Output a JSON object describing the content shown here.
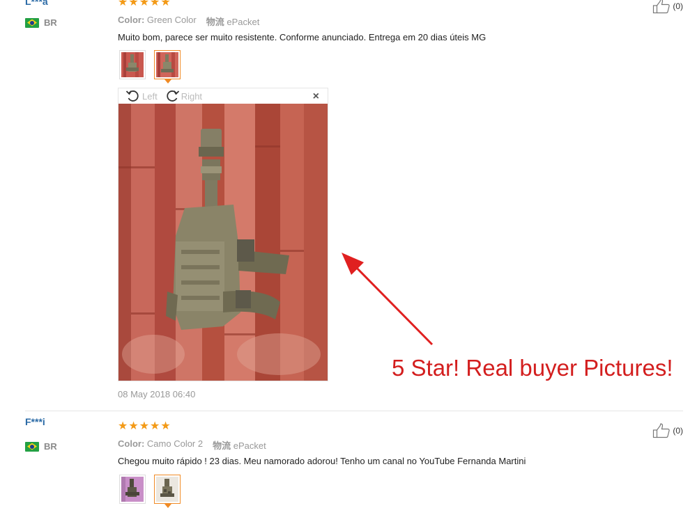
{
  "reviews": [
    {
      "username": "L***a",
      "country": "BR",
      "stars": [
        "★",
        "★",
        "★",
        "★",
        "★"
      ],
      "helpful": "(0)",
      "color_label": "Color:",
      "color_value": "Green Color",
      "shipping_label": "物流",
      "shipping_value": "ePacket",
      "comment": "Muito bom, parece ser muito resistente. Conforme anunciado. Entrega em 20 dias úteis MG",
      "date": "08 May 2018 06:40"
    },
    {
      "username": "F***i",
      "country": "BR",
      "stars": [
        "★",
        "★",
        "★",
        "★",
        "★"
      ],
      "helpful": "(0)",
      "color_label": "Color:",
      "color_value": "Camo Color 2",
      "shipping_label": "物流",
      "shipping_value": "ePacket",
      "comment": "Chegou muito rápido ! 23 dias. Meu namorado adorou! Tenho um canal no YouTube Fernanda Martini"
    }
  ],
  "viewer": {
    "rotate_left": "Left",
    "rotate_right": "Right",
    "close": "×"
  },
  "promo_text": "5 Star! Real buyer Pictures!",
  "colors": {
    "username": "#2a6aa6",
    "star": "#f39a17",
    "promo": "#d31e1e",
    "active_thumb": "#f08a24"
  }
}
